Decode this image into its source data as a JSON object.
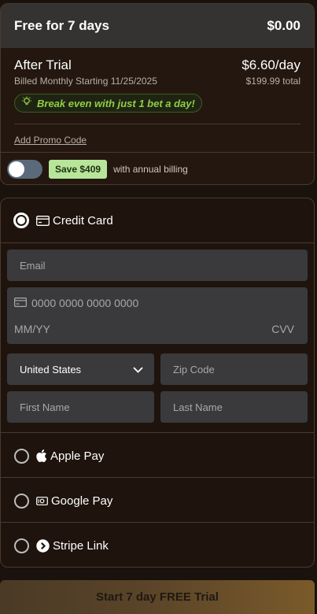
{
  "summary": {
    "trial_label": "Free for 7 days",
    "trial_price": "$0.00",
    "after_label": "After Trial",
    "after_price": "$6.60/day",
    "billing_note": "Billed Monthly Starting 11/25/2025",
    "total": "$199.99 total",
    "tip": "Break even with just 1 bet a day!",
    "promo_link": "Add Promo Code",
    "save_badge": "Save $409",
    "annual_text": "with annual billing",
    "annual_toggle_on": false
  },
  "payment": {
    "methods": [
      {
        "label": "Credit Card",
        "icon": "credit-card-icon",
        "selected": true
      },
      {
        "label": "Apple Pay",
        "icon": "apple-icon",
        "selected": false
      },
      {
        "label": "Google Pay",
        "icon": "google-pay-icon",
        "selected": false
      },
      {
        "label": "Stripe Link",
        "icon": "stripe-link-icon",
        "selected": false
      }
    ],
    "email_placeholder": "Email",
    "card_number_placeholder": "0000 0000 0000 0000",
    "expiry_placeholder": "MM/YY",
    "cvv_placeholder": "CVV",
    "country_value": "United States",
    "zip_placeholder": "Zip Code",
    "first_name_placeholder": "First Name",
    "last_name_placeholder": "Last Name"
  },
  "cta_label": "Start 7 day FREE Trial",
  "colors": {
    "accent_green": "#8fcf45",
    "badge_green": "#b7e59a",
    "background": "#1a120c"
  }
}
